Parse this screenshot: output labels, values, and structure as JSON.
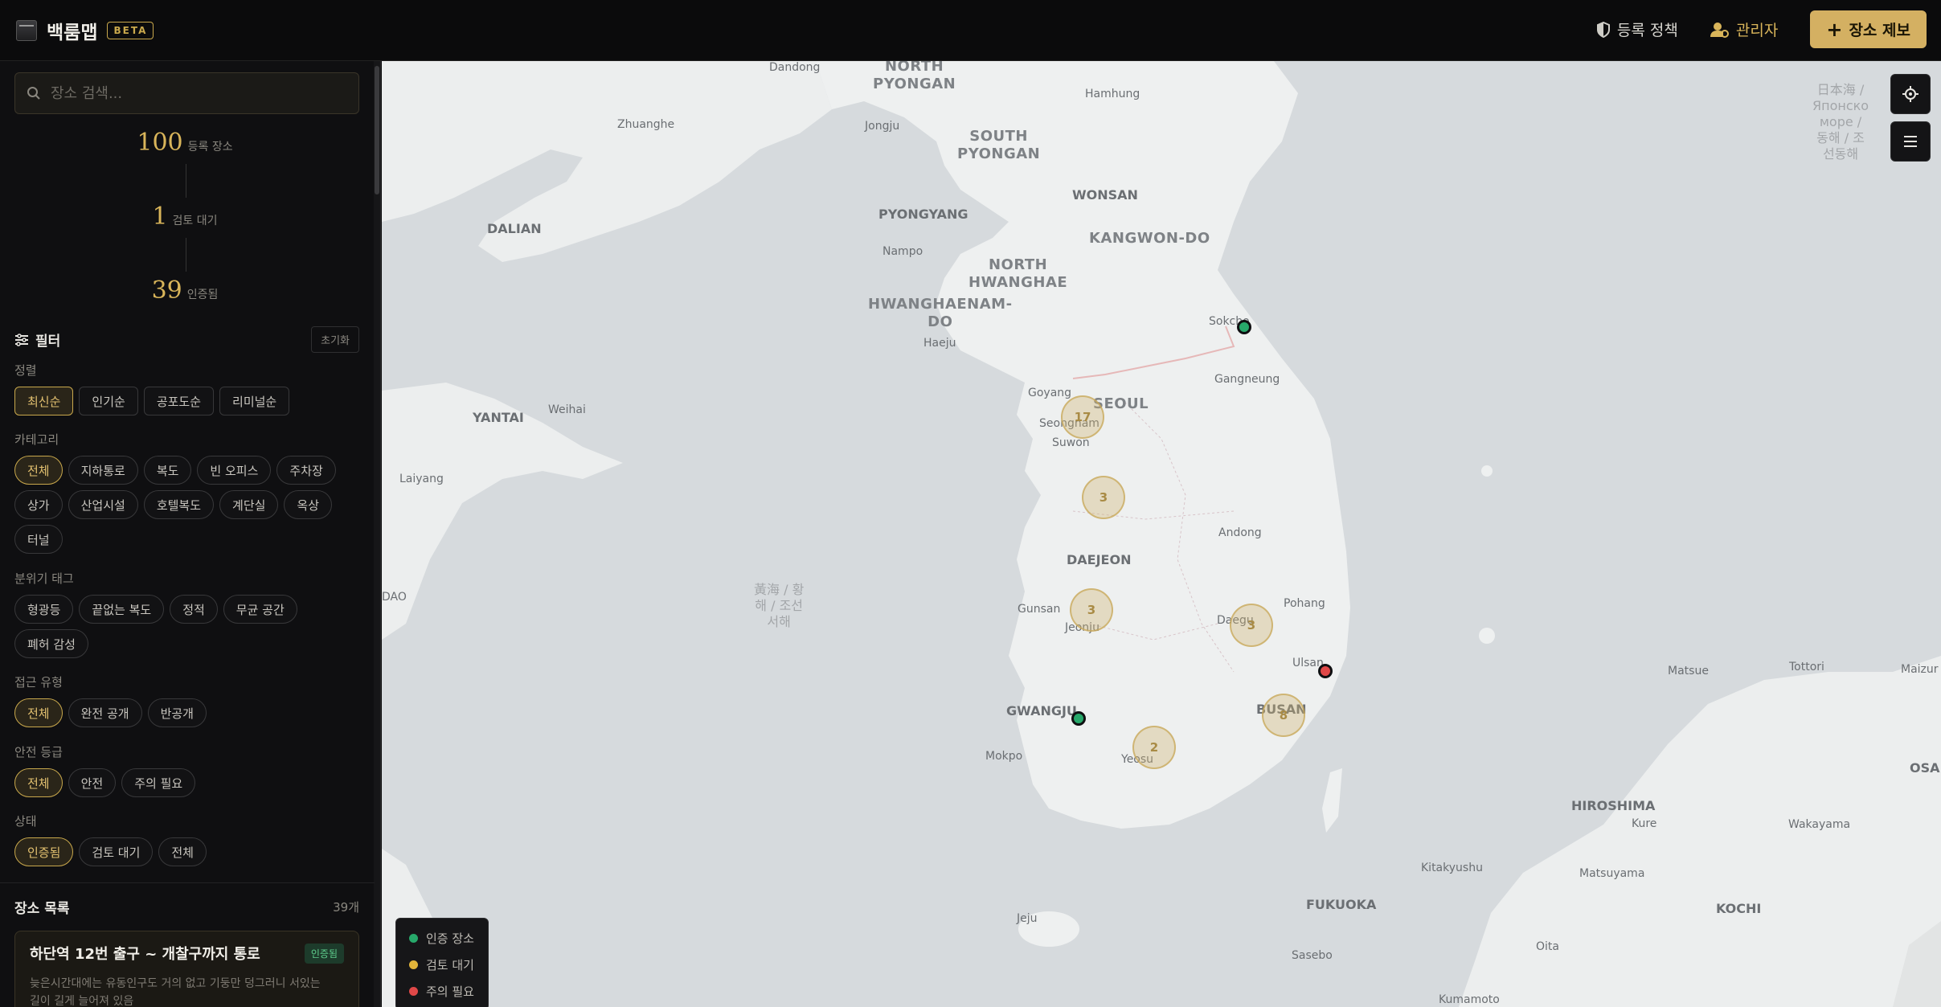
{
  "header": {
    "brand": "백룸맵",
    "beta": "BETA",
    "policy_link": "등록 정책",
    "admin_link": "관리자",
    "submit_button": "장소 제보"
  },
  "search": {
    "placeholder": "장소 검색..."
  },
  "stats": [
    {
      "value": "100",
      "label": "등록 장소"
    },
    {
      "value": "1",
      "label": "검토 대기"
    },
    {
      "value": "39",
      "label": "인증됨"
    }
  ],
  "filters": {
    "title": "필터",
    "reset": "초기화",
    "sort": {
      "label": "정렬",
      "options": [
        "최신순",
        "인기순",
        "공포도순",
        "리미널순"
      ],
      "active": 0
    },
    "category": {
      "label": "카테고리",
      "options": [
        "전체",
        "지하통로",
        "복도",
        "빈 오피스",
        "주차장",
        "상가",
        "산업시설",
        "호텔복도",
        "계단실",
        "옥상",
        "터널"
      ],
      "active": 0
    },
    "mood": {
      "label": "분위기 태그",
      "options": [
        "형광등",
        "끝없는 복도",
        "정적",
        "무균 공간",
        "폐허 감성"
      ]
    },
    "access": {
      "label": "접근 유형",
      "options": [
        "전체",
        "완전 공개",
        "반공개"
      ],
      "active": 0
    },
    "safety": {
      "label": "안전 등급",
      "options": [
        "전체",
        "안전",
        "주의 필요"
      ],
      "active": 0
    },
    "status": {
      "label": "상태",
      "options": [
        "인증됨",
        "검토 대기",
        "전체"
      ],
      "active": 0
    }
  },
  "list": {
    "title": "장소 목록",
    "count": "39개",
    "first_card": {
      "title": "하단역 12번 출구 ~ 개찰구까지 통로",
      "badge": "인증됨",
      "desc_line1": "늦은시간대에는 유동인구도 거의 없고 기둥만 덩그러니 서있는",
      "desc_line2": "길이 길게 늘어져 있음"
    }
  },
  "map": {
    "places": [
      {
        "id": "dandong",
        "text": "Dandong"
      },
      {
        "id": "np",
        "text": "NORTH\nPYONGAN"
      },
      {
        "id": "hamhung",
        "text": "Hamhung"
      },
      {
        "id": "zhuanghe",
        "text": "Zhuanghe"
      },
      {
        "id": "jongju",
        "text": "Jongju"
      },
      {
        "id": "sp",
        "text": "SOUTH\nPYONGAN"
      },
      {
        "id": "wonsan",
        "text": "WONSAN"
      },
      {
        "id": "dalian",
        "text": "DALIAN"
      },
      {
        "id": "pyongyang",
        "text": "PYONGYANG"
      },
      {
        "id": "kangwon",
        "text": "KANGWON-DO"
      },
      {
        "id": "nampo",
        "text": "Nampo"
      },
      {
        "id": "nh",
        "text": "NORTH\nHWANGHAE"
      },
      {
        "id": "hwnam",
        "text": "HWANGHAENAM-\nDO"
      },
      {
        "id": "sokcho",
        "text": "Sokcho"
      },
      {
        "id": "haeju",
        "text": "Haeju"
      },
      {
        "id": "gangneung",
        "text": "Gangneung"
      },
      {
        "id": "yantai",
        "text": "YANTAI"
      },
      {
        "id": "weihai",
        "text": "Weihai"
      },
      {
        "id": "goyang",
        "text": "Goyang"
      },
      {
        "id": "seoul",
        "text": "SEOUL"
      },
      {
        "id": "seongnam",
        "text": "Seongnam"
      },
      {
        "id": "suwon",
        "text": "Suwon"
      },
      {
        "id": "laiyang",
        "text": "Laiyang"
      },
      {
        "id": "andong",
        "text": "Andong"
      },
      {
        "id": "daejeon",
        "text": "DAEJEON"
      },
      {
        "id": "qingdao",
        "text": "DAO"
      },
      {
        "id": "sea",
        "text": "黃海 / 황\n해 / 조선\n서해"
      },
      {
        "id": "gunsan",
        "text": "Gunsan"
      },
      {
        "id": "pohang",
        "text": "Pohang"
      },
      {
        "id": "jeonju",
        "text": "Jeonju"
      },
      {
        "id": "daegu",
        "text": "Daegu"
      },
      {
        "id": "ulsan",
        "text": "Ulsan"
      },
      {
        "id": "gwangju",
        "text": "GWANGJU"
      },
      {
        "id": "busan",
        "text": "BUSAN"
      },
      {
        "id": "mokpo",
        "text": "Mokpo"
      },
      {
        "id": "yeosu",
        "text": "Yeosu"
      },
      {
        "id": "matsue",
        "text": "Matsue"
      },
      {
        "id": "tottori",
        "text": "Tottori"
      },
      {
        "id": "maizuru",
        "text": "Maizur"
      },
      {
        "id": "hiroshima",
        "text": "HIROSHIMA"
      },
      {
        "id": "kure",
        "text": "Kure"
      },
      {
        "id": "wakayama",
        "text": "Wakayama"
      },
      {
        "id": "osaka",
        "text": "OSA"
      },
      {
        "id": "kitakyushu",
        "text": "Kitakyushu"
      },
      {
        "id": "matsuyama",
        "text": "Matsuyama"
      },
      {
        "id": "fukuoka",
        "text": "FUKUOKA"
      },
      {
        "id": "kochi",
        "text": "KOCHI"
      },
      {
        "id": "jeju",
        "text": "Jeju"
      },
      {
        "id": "oita",
        "text": "Oita"
      },
      {
        "id": "sasebo",
        "text": "Sasebo"
      },
      {
        "id": "kumamoto",
        "text": "Kumamoto"
      },
      {
        "id": "eastsea",
        "text": "日本海 /\nЯпонско\nморе /\n동해 / 조\n선동해"
      }
    ],
    "clusters": [
      {
        "id": "c-seoul",
        "count": "17"
      },
      {
        "id": "c-chungcheong",
        "count": "3"
      },
      {
        "id": "c-jeonju",
        "count": "3"
      },
      {
        "id": "c-daegu",
        "count": "3"
      },
      {
        "id": "c-busan",
        "count": "8"
      },
      {
        "id": "c-yeosu",
        "count": "2"
      }
    ]
  },
  "legend": {
    "items": [
      {
        "label": "인증 장소",
        "color": "#27a86a"
      },
      {
        "label": "검토 대기",
        "color": "#e2b53a"
      },
      {
        "label": "주의 필요",
        "color": "#e04848"
      }
    ]
  },
  "colors": {
    "accent": "#d4b062",
    "verified": "#27a86a",
    "pending": "#e2b53a",
    "warning": "#e04848"
  }
}
